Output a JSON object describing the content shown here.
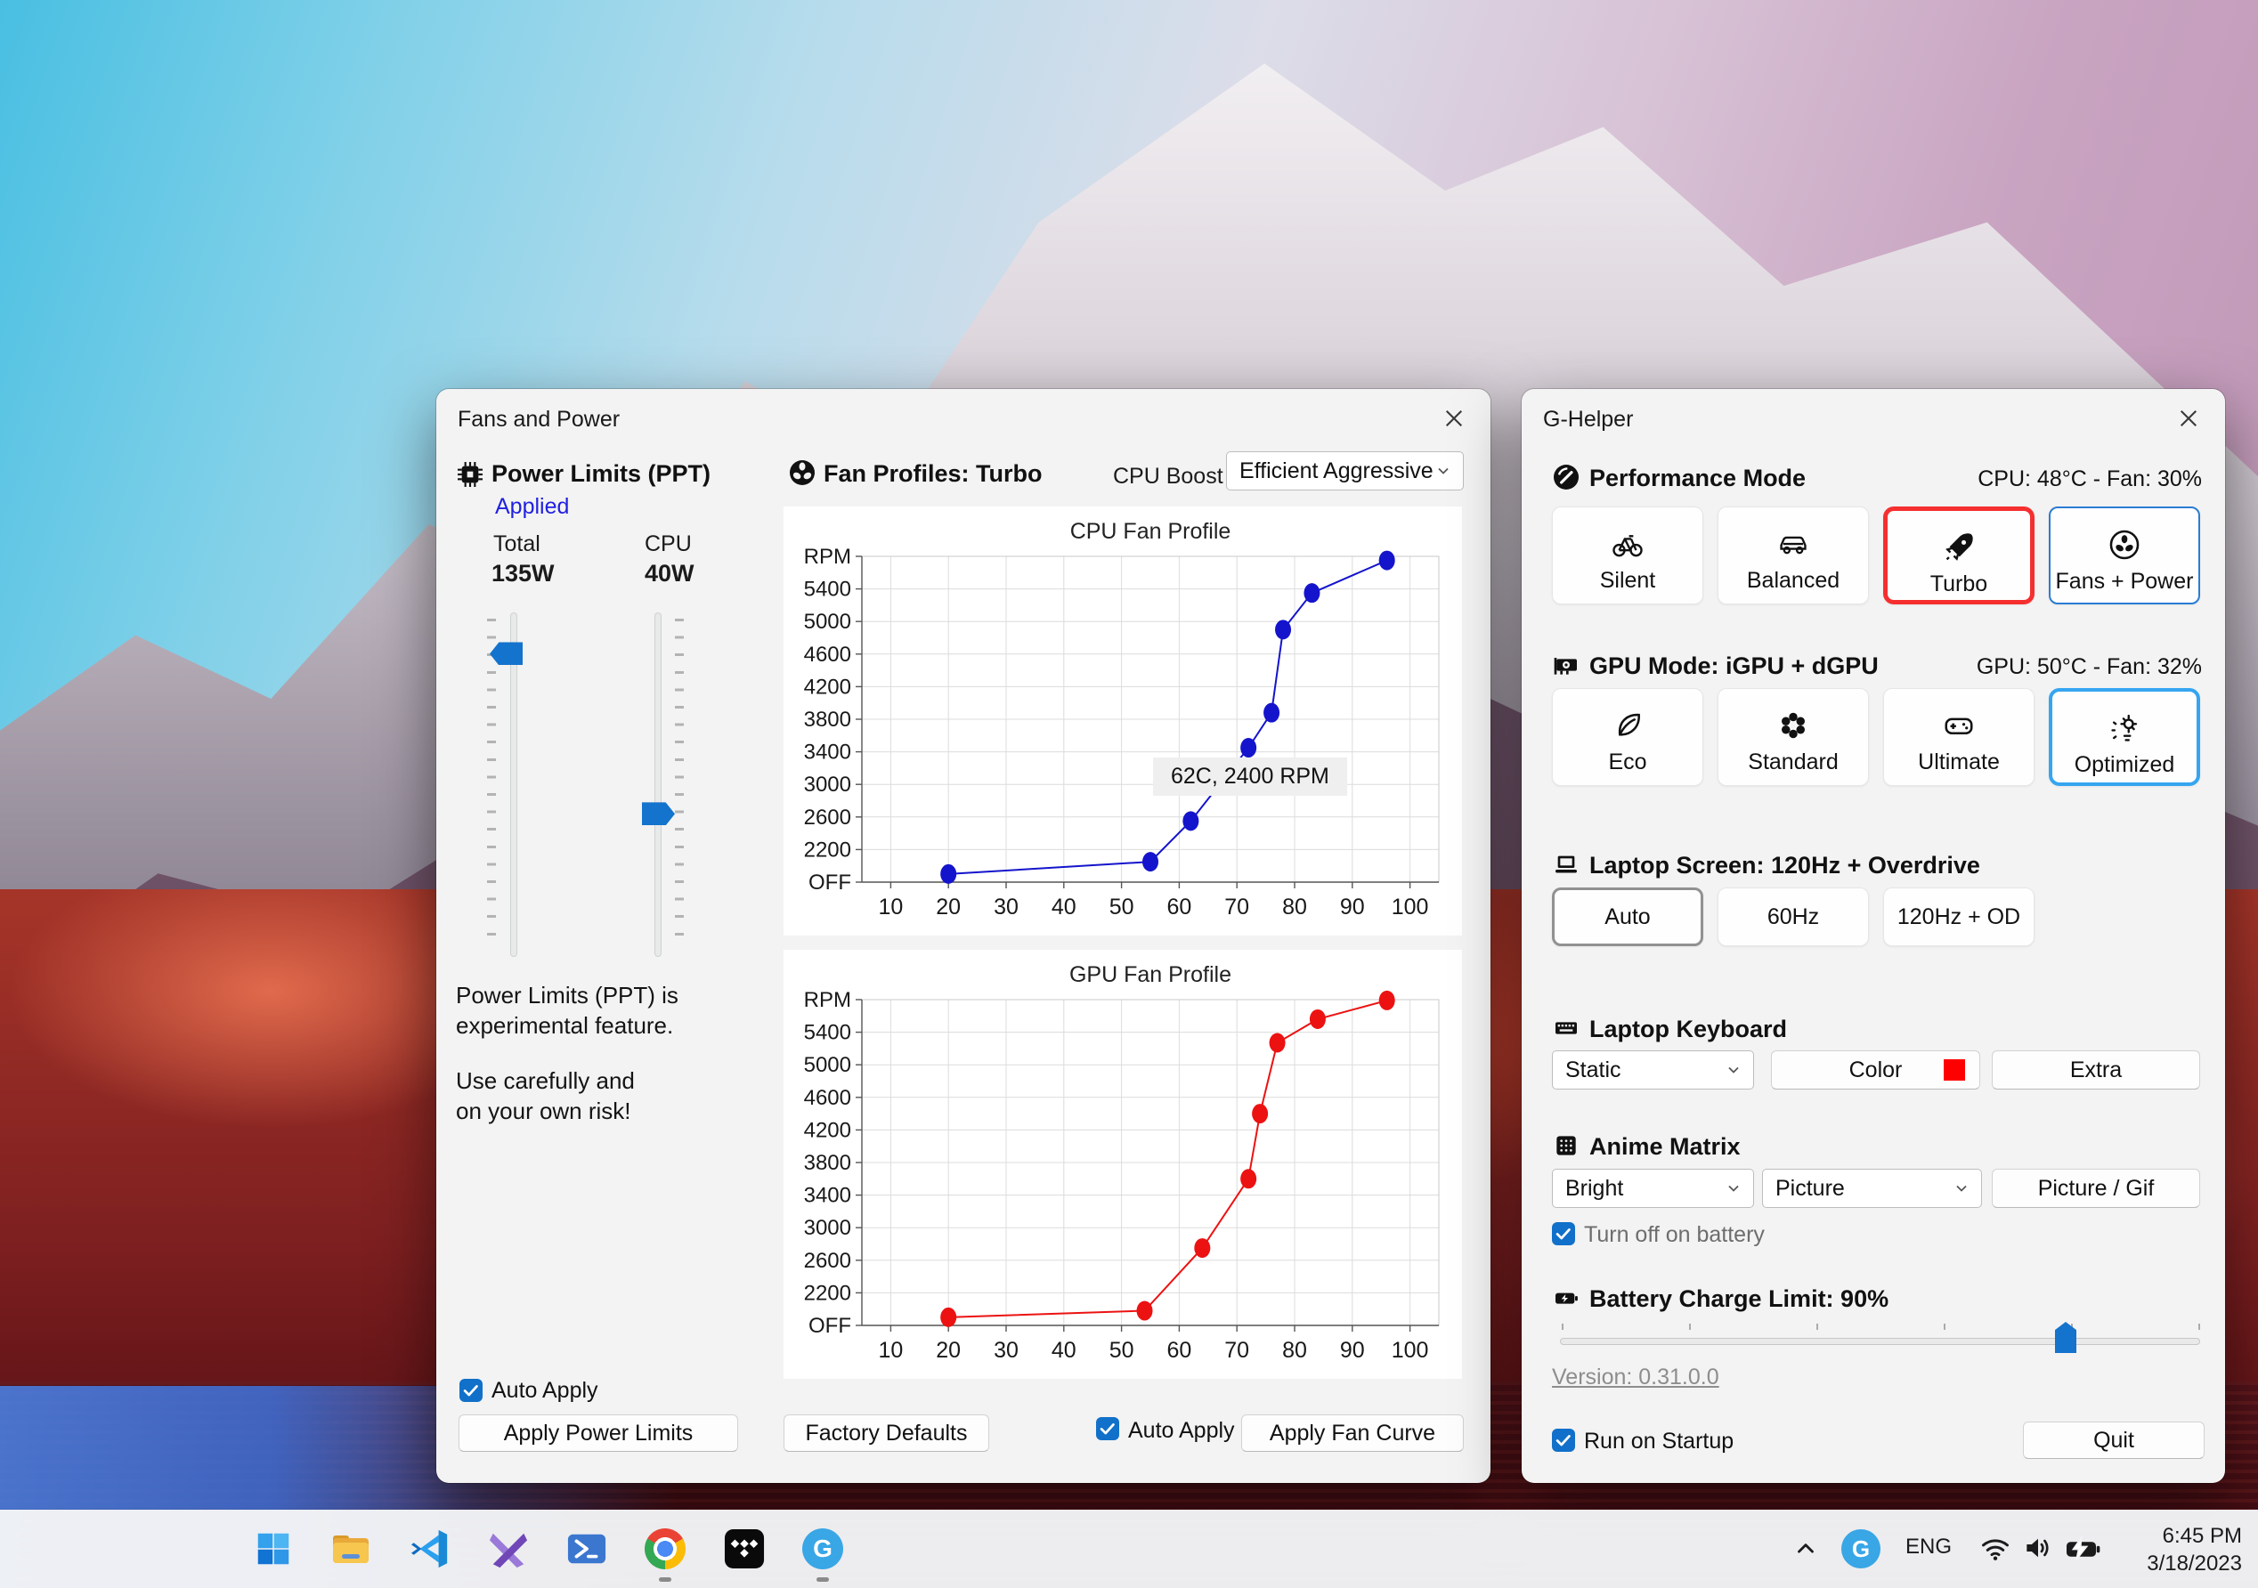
{
  "fans_window": {
    "title": "Fans and Power",
    "power_limits": {
      "heading": "Power Limits (PPT)",
      "status": "Applied",
      "total_label": "Total",
      "total_value": "135W",
      "cpu_label": "CPU",
      "cpu_value": "40W",
      "total_slider_pos": 0.12,
      "cpu_slider_pos": 0.585,
      "note1": "Power Limits (PPT) is\nexperimental feature.",
      "note2": "Use carefully and\non your own risk!",
      "auto_apply_label": "Auto Apply",
      "apply_button": "Apply Power Limits"
    },
    "fan_profiles": {
      "heading": "Fan Profiles: Turbo",
      "cpu_boost_label": "CPU Boost",
      "cpu_boost_value": "Efficient Aggressive",
      "factory_defaults_button": "Factory Defaults",
      "auto_apply_label": "Auto Apply",
      "apply_button": "Apply Fan Curve"
    }
  },
  "chart_data": [
    {
      "type": "line",
      "title": "CPU Fan Profile",
      "xlabel": "",
      "ylabel": "",
      "x_range": [
        5,
        105
      ],
      "x_ticks": [
        10,
        20,
        30,
        40,
        50,
        60,
        70,
        80,
        90,
        100
      ],
      "y_tick_labels": [
        "OFF",
        "2200",
        "2600",
        "3000",
        "3400",
        "3800",
        "4200",
        "4600",
        "5000",
        "5400",
        "RPM"
      ],
      "y_baseline_value": 1800,
      "y_step": 400,
      "grid": true,
      "annotation": "62C, 2400 RPM",
      "series": [
        {
          "name": "CPU fan curve",
          "color": "#1414cc",
          "points": [
            [
              20,
              1900
            ],
            [
              55,
              2050
            ],
            [
              62,
              2550
            ],
            [
              72,
              3450
            ],
            [
              76,
              3880
            ],
            [
              78,
              4900
            ],
            [
              83,
              5350
            ],
            [
              96,
              5750
            ]
          ]
        }
      ]
    },
    {
      "type": "line",
      "title": "GPU Fan Profile",
      "xlabel": "",
      "ylabel": "",
      "x_range": [
        5,
        105
      ],
      "x_ticks": [
        10,
        20,
        30,
        40,
        50,
        60,
        70,
        80,
        90,
        100
      ],
      "y_tick_labels": [
        "OFF",
        "2200",
        "2600",
        "3000",
        "3400",
        "3800",
        "4200",
        "4600",
        "5000",
        "5400",
        "RPM"
      ],
      "y_baseline_value": 1800,
      "y_step": 400,
      "grid": true,
      "annotation": "",
      "series": [
        {
          "name": "GPU fan curve",
          "color": "#ec1212",
          "points": [
            [
              20,
              1900
            ],
            [
              54,
              1980
            ],
            [
              64,
              2750
            ],
            [
              72,
              3600
            ],
            [
              74,
              4400
            ],
            [
              77,
              5270
            ],
            [
              84,
              5560
            ],
            [
              96,
              5790
            ]
          ]
        }
      ]
    }
  ],
  "ghelper_window": {
    "title": "G-Helper",
    "performance": {
      "heading": "Performance Mode",
      "status": "CPU: 48°C  -  Fan: 30%",
      "selected": "Turbo",
      "buttons": [
        {
          "label": "Silent",
          "icon": "bicycle-icon"
        },
        {
          "label": "Balanced",
          "icon": "car-icon"
        },
        {
          "label": "Turbo",
          "icon": "rocket-icon"
        },
        {
          "label": "Fans + Power",
          "icon": "fan-icon"
        }
      ]
    },
    "gpu": {
      "heading": "GPU Mode: iGPU + dGPU",
      "status": "GPU: 50°C  -  Fan: 32%",
      "selected": "Optimized",
      "buttons": [
        {
          "label": "Eco",
          "icon": "leaf-icon"
        },
        {
          "label": "Standard",
          "icon": "flower-icon"
        },
        {
          "label": "Ultimate",
          "icon": "gamepad-icon"
        },
        {
          "label": "Optimized",
          "icon": "sparkle-gear-icon"
        }
      ]
    },
    "screen": {
      "heading": "Laptop Screen: 120Hz + Overdrive",
      "selected": "Auto",
      "buttons": [
        {
          "label": "Auto"
        },
        {
          "label": "60Hz"
        },
        {
          "label": "120Hz + OD"
        }
      ]
    },
    "keyboard": {
      "heading": "Laptop Keyboard",
      "mode_value": "Static",
      "color_button": "Color",
      "color_swatch": "#ff0000",
      "extra_button": "Extra"
    },
    "matrix": {
      "heading": "Anime Matrix",
      "brightness_value": "Bright",
      "content_value": "Picture",
      "picture_button": "Picture / Gif",
      "battery_checkbox_label": "Turn off on battery"
    },
    "battery": {
      "heading": "Battery Charge Limit: 90%",
      "percent": 90,
      "slider_pos": 0.79
    },
    "version_link": "Version: 0.31.0.0",
    "startup_checkbox_label": "Run on Startup",
    "quit_button": "Quit"
  },
  "taskbar": {
    "apps": [
      {
        "icon": "start-icon",
        "running": false
      },
      {
        "icon": "file-explorer-icon",
        "running": false
      },
      {
        "icon": "vscode-icon",
        "running": false
      },
      {
        "icon": "visual-studio-icon",
        "running": false
      },
      {
        "icon": "powershell-icon",
        "running": false
      },
      {
        "icon": "chrome-icon",
        "running": true
      },
      {
        "icon": "tidal-icon",
        "running": false
      },
      {
        "icon": "ghelper-icon",
        "running": true
      }
    ],
    "tray": {
      "language": "ENG",
      "time": "6:45 PM",
      "date": "3/18/2023"
    }
  },
  "colors": {
    "accent_blue": "#1473cc",
    "selected_red": "#f52f2f",
    "selected_blue": "#2b7cd3",
    "optimized_blue": "#35a5f0",
    "applied_blue": "#2121e0",
    "cpu_curve": "#1414cc",
    "gpu_curve": "#ec1212"
  }
}
